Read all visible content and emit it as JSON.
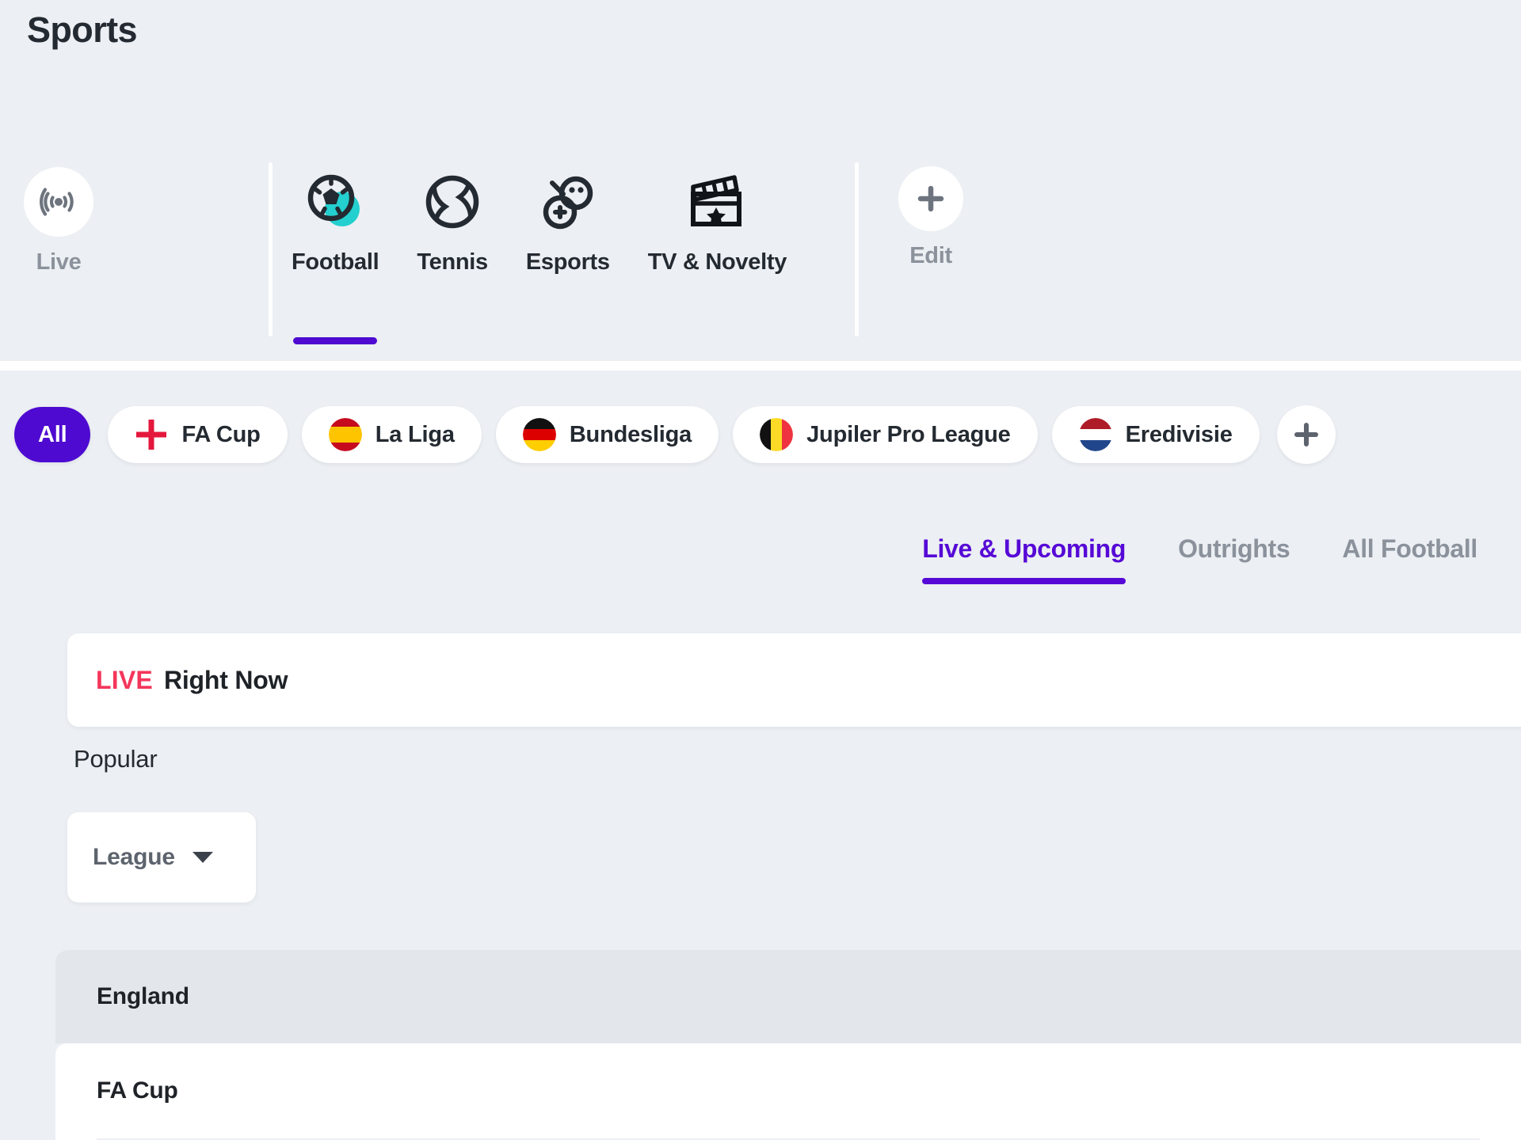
{
  "header": {
    "title": "Sports"
  },
  "sport_nav": {
    "live": {
      "label": "Live",
      "icon": "radar-icon"
    },
    "items": [
      {
        "label": "Football",
        "icon": "football-icon",
        "active": true
      },
      {
        "label": "Tennis",
        "icon": "tennis-ball-icon",
        "active": false
      },
      {
        "label": "Esports",
        "icon": "gamepad-icon",
        "active": false
      },
      {
        "label": "TV & Novelty",
        "icon": "clapperboard-icon",
        "active": false
      }
    ],
    "edit": {
      "label": "Edit",
      "icon": "plus-icon"
    }
  },
  "league_pills": {
    "all_label": "All",
    "items": [
      {
        "label": "FA Cup",
        "flag": "england-flag"
      },
      {
        "label": "La Liga",
        "flag": "spain-flag"
      },
      {
        "label": "Bundesliga",
        "flag": "germany-flag"
      },
      {
        "label": "Jupiler Pro League",
        "flag": "belgium-flag"
      },
      {
        "label": "Eredivisie",
        "flag": "netherlands-flag"
      }
    ],
    "add_icon": "plus-icon"
  },
  "tabs": [
    {
      "label": "Live & Upcoming",
      "active": true
    },
    {
      "label": "Outrights",
      "active": false
    },
    {
      "label": "All Football",
      "active": false
    }
  ],
  "live_card": {
    "badge": "LIVE",
    "title": "Right Now"
  },
  "popular": {
    "heading": "Popular",
    "filter_label": "League",
    "filter_icon": "chevron-down-icon"
  },
  "country_groups": [
    {
      "country": "England",
      "leagues": [
        {
          "name": "FA Cup"
        }
      ]
    }
  ],
  "colors": {
    "background": "#eceff3",
    "accent_purple": "#4e0ad0",
    "tab_purple": "#5609d6",
    "live_red": "#f4365b",
    "teal": "#23cfcf",
    "muted_text": "#8b929c",
    "group_header": "#e3e7ec"
  }
}
